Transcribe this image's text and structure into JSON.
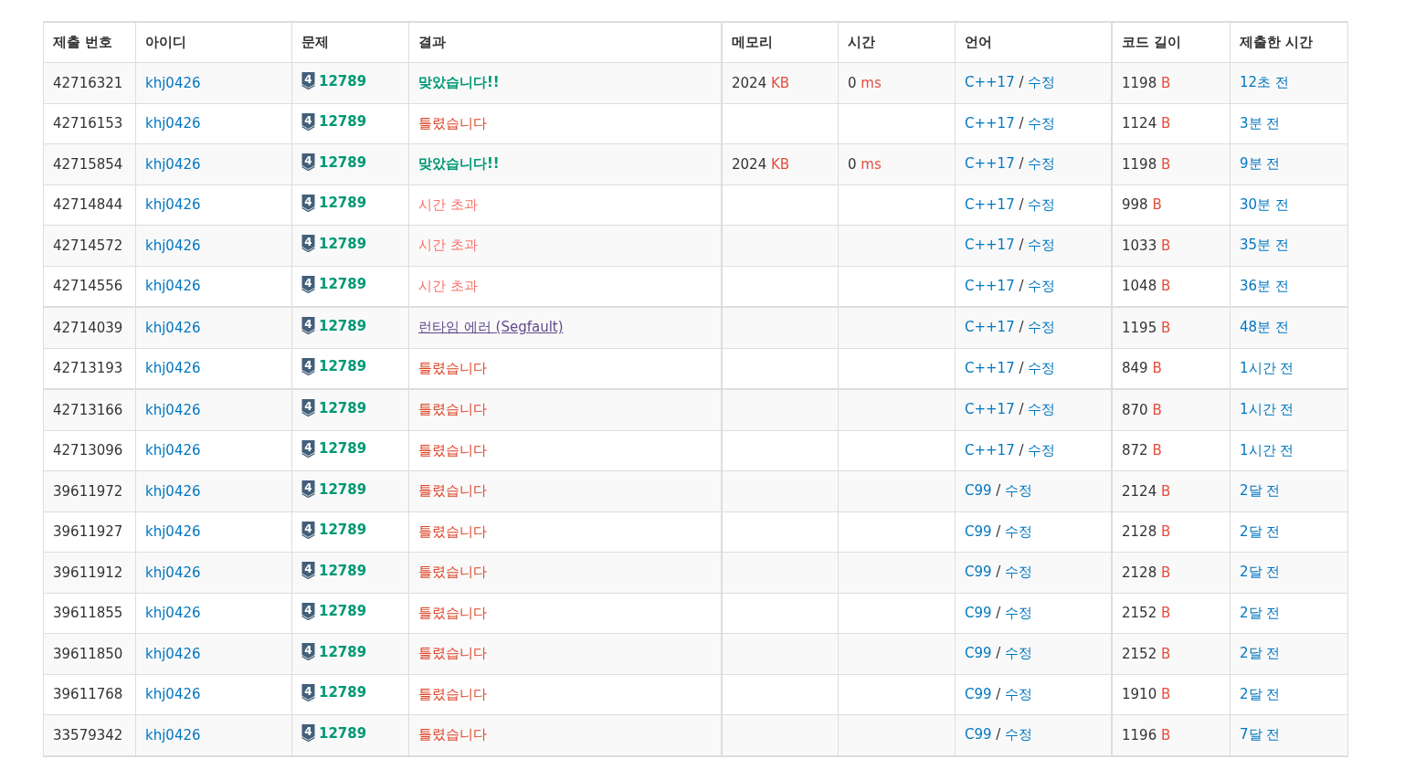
{
  "table": {
    "columns": [
      "제출 번호",
      "아이디",
      "문제",
      "결과",
      "메모리",
      "시간",
      "언어",
      "코드 길이",
      "제출한 시간"
    ],
    "rows": [
      {
        "id": "42716321",
        "user": "khj0426",
        "tier": "4",
        "problem": "12789",
        "result": {
          "kind": "ac",
          "text": "맞았습니다!!"
        },
        "memory": "2024",
        "memory_unit": "KB",
        "time": "0",
        "time_unit": "ms",
        "language": "C++17",
        "separator": "/",
        "edit": "수정",
        "length": "1198",
        "length_unit": "B",
        "submitted": "12초 전"
      },
      {
        "id": "42716153",
        "user": "khj0426",
        "tier": "4",
        "problem": "12789",
        "result": {
          "kind": "wa",
          "text": "틀렸습니다"
        },
        "language": "C++17",
        "separator": "/",
        "edit": "수정",
        "length": "1124",
        "length_unit": "B",
        "submitted": "3분 전"
      },
      {
        "id": "42715854",
        "user": "khj0426",
        "tier": "4",
        "problem": "12789",
        "result": {
          "kind": "ac",
          "text": "맞았습니다!!"
        },
        "memory": "2024",
        "memory_unit": "KB",
        "time": "0",
        "time_unit": "ms",
        "language": "C++17",
        "separator": "/",
        "edit": "수정",
        "length": "1198",
        "length_unit": "B",
        "submitted": "9분 전"
      },
      {
        "id": "42714844",
        "user": "khj0426",
        "tier": "4",
        "problem": "12789",
        "result": {
          "kind": "tle",
          "text": "시간 초과"
        },
        "language": "C++17",
        "separator": "/",
        "edit": "수정",
        "length": "998",
        "length_unit": "B",
        "submitted": "30분 전"
      },
      {
        "id": "42714572",
        "user": "khj0426",
        "tier": "4",
        "problem": "12789",
        "result": {
          "kind": "tle",
          "text": "시간 초과"
        },
        "language": "C++17",
        "separator": "/",
        "edit": "수정",
        "length": "1033",
        "length_unit": "B",
        "submitted": "35분 전"
      },
      {
        "id": "42714556",
        "user": "khj0426",
        "tier": "4",
        "problem": "12789",
        "result": {
          "kind": "tle",
          "text": "시간 초과"
        },
        "language": "C++17",
        "separator": "/",
        "edit": "수정",
        "length": "1048",
        "length_unit": "B",
        "submitted": "36분 전"
      },
      {
        "id": "42714039",
        "user": "khj0426",
        "tier": "4",
        "problem": "12789",
        "result": {
          "kind": "rte",
          "text": "런타임 에러 (Segfault)"
        },
        "language": "C++17",
        "separator": "/",
        "edit": "수정",
        "length": "1195",
        "length_unit": "B",
        "submitted": "48분 전"
      },
      {
        "id": "42713193",
        "user": "khj0426",
        "tier": "4",
        "problem": "12789",
        "result": {
          "kind": "wa",
          "text": "틀렸습니다"
        },
        "language": "C++17",
        "separator": "/",
        "edit": "수정",
        "length": "849",
        "length_unit": "B",
        "submitted": "1시간 전"
      },
      {
        "id": "42713166",
        "user": "khj0426",
        "tier": "4",
        "problem": "12789",
        "result": {
          "kind": "wa",
          "text": "틀렸습니다"
        },
        "language": "C++17",
        "separator": "/",
        "edit": "수정",
        "length": "870",
        "length_unit": "B",
        "submitted": "1시간 전"
      },
      {
        "id": "42713096",
        "user": "khj0426",
        "tier": "4",
        "problem": "12789",
        "result": {
          "kind": "wa",
          "text": "틀렸습니다"
        },
        "language": "C++17",
        "separator": "/",
        "edit": "수정",
        "length": "872",
        "length_unit": "B",
        "submitted": "1시간 전"
      },
      {
        "id": "39611972",
        "user": "khj0426",
        "tier": "4",
        "problem": "12789",
        "result": {
          "kind": "wa",
          "text": "틀렸습니다"
        },
        "language": "C99",
        "separator": "/",
        "edit": "수정",
        "length": "2124",
        "length_unit": "B",
        "submitted": "2달 전"
      },
      {
        "id": "39611927",
        "user": "khj0426",
        "tier": "4",
        "problem": "12789",
        "result": {
          "kind": "wa",
          "text": "틀렸습니다"
        },
        "language": "C99",
        "separator": "/",
        "edit": "수정",
        "length": "2128",
        "length_unit": "B",
        "submitted": "2달 전"
      },
      {
        "id": "39611912",
        "user": "khj0426",
        "tier": "4",
        "problem": "12789",
        "result": {
          "kind": "wa",
          "text": "틀렸습니다"
        },
        "language": "C99",
        "separator": "/",
        "edit": "수정",
        "length": "2128",
        "length_unit": "B",
        "submitted": "2달 전"
      },
      {
        "id": "39611855",
        "user": "khj0426",
        "tier": "4",
        "problem": "12789",
        "result": {
          "kind": "wa",
          "text": "틀렸습니다"
        },
        "language": "C99",
        "separator": "/",
        "edit": "수정",
        "length": "2152",
        "length_unit": "B",
        "submitted": "2달 전"
      },
      {
        "id": "39611850",
        "user": "khj0426",
        "tier": "4",
        "problem": "12789",
        "result": {
          "kind": "wa",
          "text": "틀렸습니다"
        },
        "language": "C99",
        "separator": "/",
        "edit": "수정",
        "length": "2152",
        "length_unit": "B",
        "submitted": "2달 전"
      },
      {
        "id": "39611768",
        "user": "khj0426",
        "tier": "4",
        "problem": "12789",
        "result": {
          "kind": "wa",
          "text": "틀렸습니다"
        },
        "language": "C99",
        "separator": "/",
        "edit": "수정",
        "length": "1910",
        "length_unit": "B",
        "submitted": "2달 전"
      },
      {
        "id": "33579342",
        "user": "khj0426",
        "tier": "4",
        "problem": "12789",
        "result": {
          "kind": "wa",
          "text": "틀렸습니다"
        },
        "language": "C99",
        "separator": "/",
        "edit": "수정",
        "length": "1196",
        "length_unit": "B",
        "submitted": "7달 전"
      }
    ]
  }
}
